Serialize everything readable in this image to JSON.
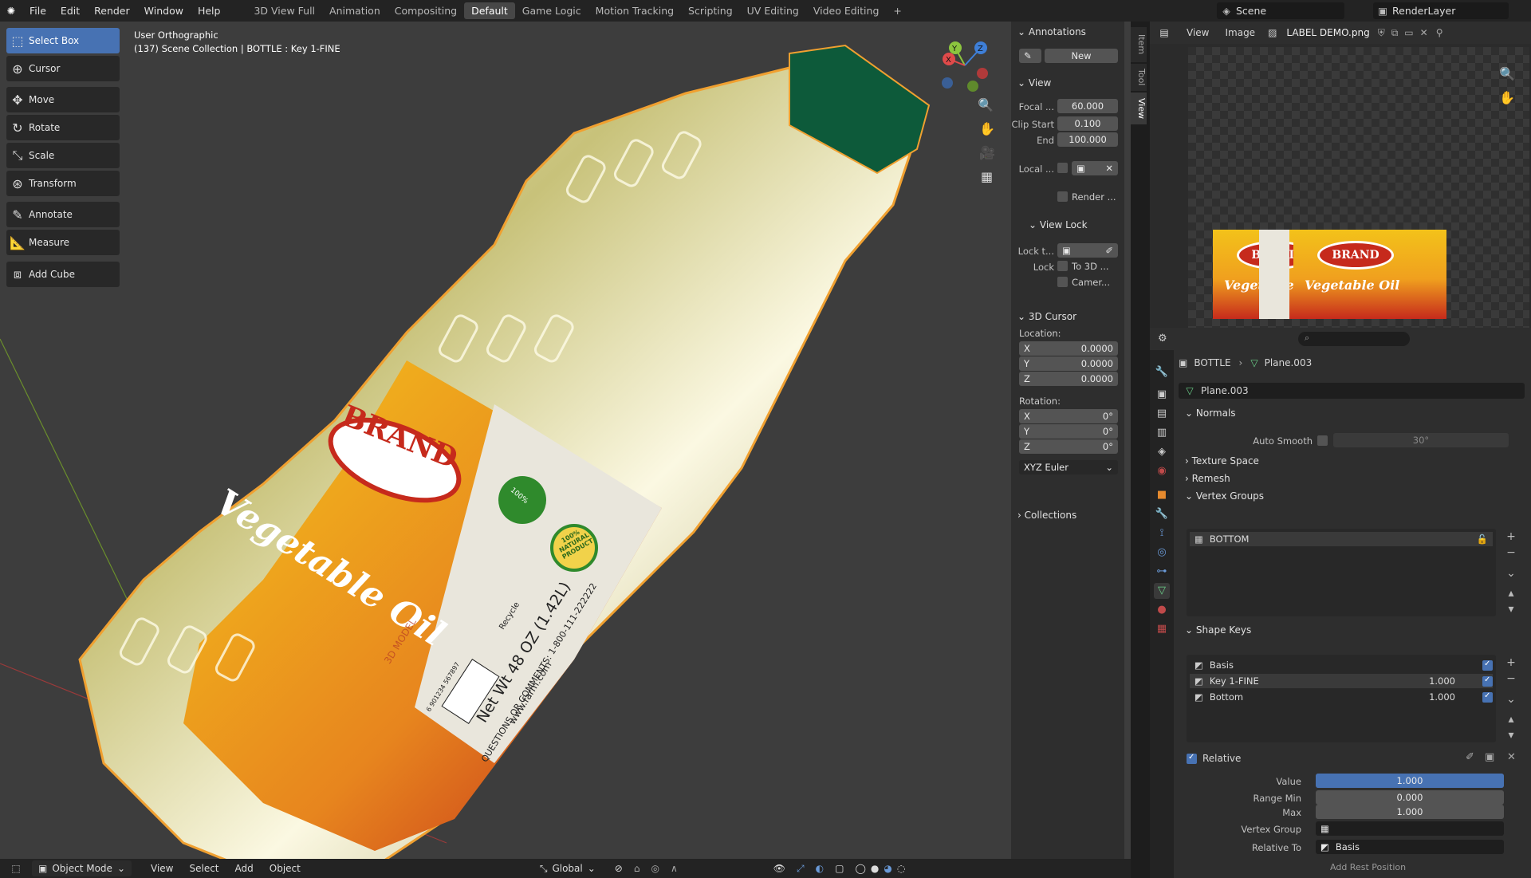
{
  "topbar": {
    "menus": [
      "File",
      "Edit",
      "Render",
      "Window",
      "Help"
    ],
    "workspaces": [
      "3D View Full",
      "Animation",
      "Compositing",
      "Default",
      "Game Logic",
      "Motion Tracking",
      "Scripting",
      "UV Editing",
      "Video Editing"
    ],
    "active_workspace": "Default",
    "add_tab": "+",
    "scene": "Scene",
    "render_layer": "RenderLayer"
  },
  "viewport": {
    "view_name": "User Orthographic",
    "collection_info": "(137) Scene Collection | BOTTLE : Key 1-FINE",
    "tools": [
      "Select Box",
      "Cursor",
      "Move",
      "Rotate",
      "Scale",
      "Transform",
      "Annotate",
      "Measure",
      "Add Cube"
    ],
    "active_tool": "Select Box",
    "gizmo_axes": {
      "x": "X",
      "y": "Y",
      "z": "Z"
    }
  },
  "label": {
    "brand": "BRAND",
    "product": "Vegetable Oil",
    "badge": "100%",
    "badge2": "100% NATURAL PRODUCT",
    "recycle": "Recycle",
    "net_wt": "Net Wt 48 OZ (1.42L)",
    "questions": "QUESTIONS OR COMMENTS: 1-800-111-222222",
    "website": "www.farm.com",
    "model_tag": "3D MODEL",
    "barcode_num": "6 901234 567897"
  },
  "npanel": {
    "annotations": "Annotations",
    "new_label": "New",
    "view_section": "View",
    "focal_label": "Focal ...",
    "focal_value": "60.000",
    "clip_start_label": "Clip Start",
    "clip_start_value": "0.100",
    "end_label": "End",
    "end_value": "100.000",
    "local_label": "Local ...",
    "render_label": "Render ...",
    "view_lock": "View Lock",
    "lock_to_label": "Lock t...",
    "lock_label": "Lock",
    "to_3d": "To 3D ...",
    "camera": "Camer...",
    "cursor_section": "3D Cursor",
    "location": "Location:",
    "loc_x": "0.0000",
    "loc_y": "0.0000",
    "loc_z": "0.0000",
    "rotation": "Rotation:",
    "rot_x": "0°",
    "rot_y": "0°",
    "rot_z": "0°",
    "axis_x": "X",
    "axis_y": "Y",
    "axis_z": "Z",
    "rot_mode": "XYZ Euler",
    "collections": "Collections",
    "tabs": [
      "Item",
      "Tool",
      "View"
    ]
  },
  "image_editor": {
    "view": "View",
    "image": "Image",
    "filename": "LABEL DEMO.png"
  },
  "properties": {
    "object_name": "BOTTLE",
    "mesh_name": "Plane.003",
    "mesh_field": "Plane.003",
    "normals": "Normals",
    "auto_smooth": "Auto Smooth",
    "auto_smooth_angle": "30°",
    "texture_space": "Texture Space",
    "remesh": "Remesh",
    "vertex_groups": "Vertex Groups",
    "vgroup_items": [
      "BOTTOM"
    ],
    "shape_keys": "Shape Keys",
    "shape_key_items": [
      {
        "name": "Basis",
        "value": ""
      },
      {
        "name": "Key 1-FINE",
        "value": "1.000"
      },
      {
        "name": "Bottom",
        "value": "1.000"
      }
    ],
    "relative": "Relative",
    "value_label": "Value",
    "value": "1.000",
    "value_fraction": 1.0,
    "range_min_label": "Range Min",
    "range_min": "0.000",
    "max_label": "Max",
    "max": "1.000",
    "vertex_group_label": "Vertex Group",
    "relative_to_label": "Relative To",
    "relative_to": "Basis",
    "add_rest": "Add Rest Position"
  },
  "footer": {
    "mode": "Object Mode",
    "menus": [
      "View",
      "Select",
      "Add",
      "Object"
    ],
    "orientation": "Global"
  },
  "colors": {
    "accent": "#4772b3",
    "outline": "#f0a030",
    "label_red": "#c62a1c",
    "label_yellow": "#f3c21a",
    "cap_green": "#0d5a3a"
  }
}
